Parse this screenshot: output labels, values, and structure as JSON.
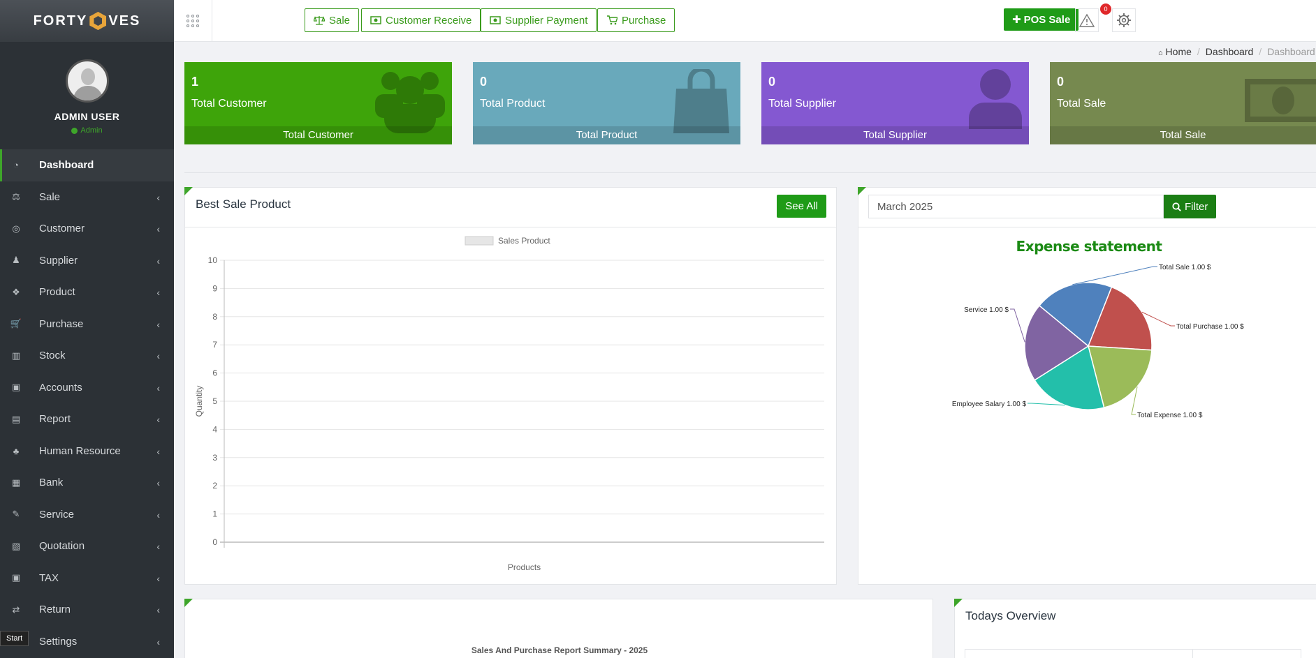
{
  "brand": {
    "left": "FORTY",
    "right": "VES"
  },
  "user": {
    "name": "ADMIN USER",
    "role": "Admin"
  },
  "sidebar": {
    "items": [
      {
        "label": "Dashboard",
        "icon": "dashboard-icon"
      },
      {
        "label": "Sale",
        "icon": "balance-scale-icon"
      },
      {
        "label": "Customer",
        "icon": "user-circle-icon"
      },
      {
        "label": "Supplier",
        "icon": "user-secret-icon"
      },
      {
        "label": "Product",
        "icon": "cubes-icon"
      },
      {
        "label": "Purchase",
        "icon": "cart-icon"
      },
      {
        "label": "Stock",
        "icon": "bar-chart-icon"
      },
      {
        "label": "Accounts",
        "icon": "money-icon"
      },
      {
        "label": "Report",
        "icon": "book-icon"
      },
      {
        "label": "Human Resource",
        "icon": "users-icon"
      },
      {
        "label": "Bank",
        "icon": "briefcase-icon"
      },
      {
        "label": "Service",
        "icon": "service-icon"
      },
      {
        "label": "Quotation",
        "icon": "quotation-icon"
      },
      {
        "label": "TAX",
        "icon": "money-icon"
      },
      {
        "label": "Return",
        "icon": "return-icon"
      },
      {
        "label": "Settings",
        "icon": "gear-icon"
      }
    ],
    "start_tooltip": "Start"
  },
  "header": {
    "buttons": [
      {
        "label": "Sale",
        "icon": "balance-scale-icon"
      },
      {
        "label": "Customer Receive",
        "icon": "money-icon"
      },
      {
        "label": "Supplier Payment",
        "icon": "money-icon"
      },
      {
        "label": "Purchase",
        "icon": "cart-icon"
      }
    ],
    "pos_label": "POS Sale",
    "alert_count": "0"
  },
  "breadcrumb": [
    "Home",
    "Dashboard",
    "Dashboard"
  ],
  "stats": [
    {
      "value": "1",
      "label": "Total Customer",
      "footer": "Total Customer",
      "color": "#3ea40a",
      "icon": "users-icon"
    },
    {
      "value": "0",
      "label": "Total Product",
      "footer": "Total Product",
      "color": "#69a9bb",
      "icon": "shopping-bag-icon"
    },
    {
      "value": "0",
      "label": "Total Supplier",
      "footer": "Total Supplier",
      "color": "#8458d1",
      "icon": "user-icon"
    },
    {
      "value": "0",
      "label": "Total Sale",
      "footer": "Total Sale",
      "color": "#76894f",
      "icon": "money-bill-icon"
    }
  ],
  "best_sale": {
    "title": "Best Sale Product",
    "see_all": "See All"
  },
  "expense": {
    "month": "March 2025",
    "filter_label": "Filter",
    "title": "Expense statement"
  },
  "summary": {
    "title": "Sales And Purchase Report Summary - 2025"
  },
  "todays": {
    "title": "Todays Overview"
  },
  "chart_data": [
    {
      "type": "bar",
      "legend": [
        "Sales Product"
      ],
      "xlabel": "Products",
      "ylabel": "Quantity",
      "ylim": [
        0,
        10
      ],
      "yticks": [
        "0",
        "1",
        "2",
        "3",
        "4",
        "5",
        "6",
        "7",
        "8",
        "9",
        "10"
      ],
      "categories": [],
      "series": [
        {
          "name": "Sales Product",
          "values": []
        }
      ]
    },
    {
      "type": "pie",
      "slices": [
        {
          "label": "Total Sale 1.00 $",
          "value": 1,
          "color": "#4f81bd"
        },
        {
          "label": "Total Purchase 1.00 $",
          "value": 1,
          "color": "#c0504d"
        },
        {
          "label": "Total Expense 1.00 $",
          "value": 1,
          "color": "#9bbb59"
        },
        {
          "label": "Employee Salary 1.00 $",
          "value": 1,
          "color": "#23bfaa"
        },
        {
          "label": "Service  1.00 $",
          "value": 1,
          "color": "#8064a2"
        }
      ]
    }
  ]
}
